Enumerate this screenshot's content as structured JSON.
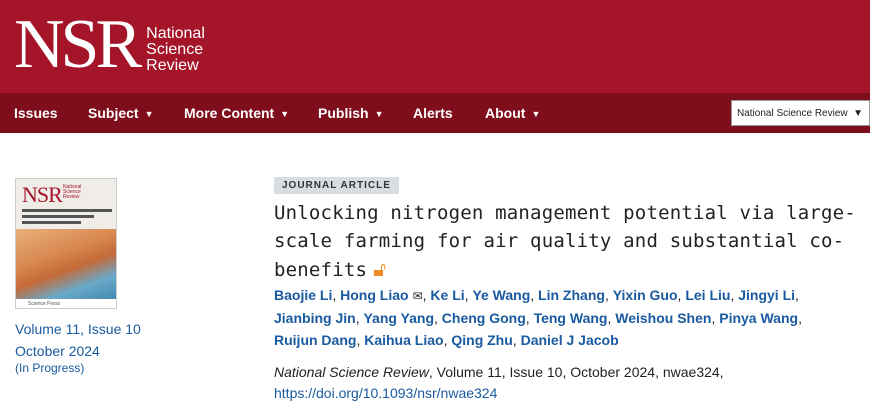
{
  "header": {
    "logo_mark": "NSR",
    "logo_text": [
      "National",
      "Science",
      "Review"
    ]
  },
  "nav": {
    "items": [
      {
        "label": "Issues",
        "has_menu": false
      },
      {
        "label": "Subject",
        "has_menu": true
      },
      {
        "label": "More Content",
        "has_menu": true
      },
      {
        "label": "Publish",
        "has_menu": true
      },
      {
        "label": "Alerts",
        "has_menu": false
      },
      {
        "label": "About",
        "has_menu": true
      }
    ],
    "menu_caret": "▼",
    "journal_select": {
      "value": "National Science Review",
      "arrow": "▼"
    }
  },
  "issue": {
    "cover": {
      "mark": "NSR",
      "name": [
        "National",
        "Science",
        "Review"
      ],
      "publisher": "Science Press"
    },
    "volume": "Volume 11, Issue 10",
    "date": "October 2024",
    "status": "(In Progress)"
  },
  "article": {
    "type": "JOURNAL ARTICLE",
    "title_lines": [
      "Unlocking nitrogen management potential via large-",
      "scale farming for air quality and substantial co-",
      "benefits"
    ],
    "open_access_icon": "open-access-icon",
    "authors_lines": [
      [
        "Baojie Li",
        "Hong Liao",
        "Ke Li",
        "Ye Wang",
        "Lin Zhang",
        "Yixin Guo",
        "Lei Liu",
        "Jingyi Li"
      ],
      [
        "Jianbing Jin",
        "Yang Yang",
        "Cheng Gong",
        "Teng Wang",
        "Weishou Shen",
        "Pinya Wang"
      ],
      [
        "Ruijun Dang",
        "Kaihua Liao",
        "Qing Zhu",
        "Daniel J Jacob"
      ]
    ],
    "corresponding_author": "Hong Liao",
    "citation_journal": "National Science Review",
    "citation_rest": ", Volume 11, Issue 10, October 2024, nwae324,",
    "doi": "https://doi.org/10.1093/nsr/nwae324"
  },
  "colors": {
    "header_bg": "#a4152a",
    "nav_bg": "#7e0e1c",
    "link": "#1a5aa0",
    "open_access": "#f08a24"
  }
}
